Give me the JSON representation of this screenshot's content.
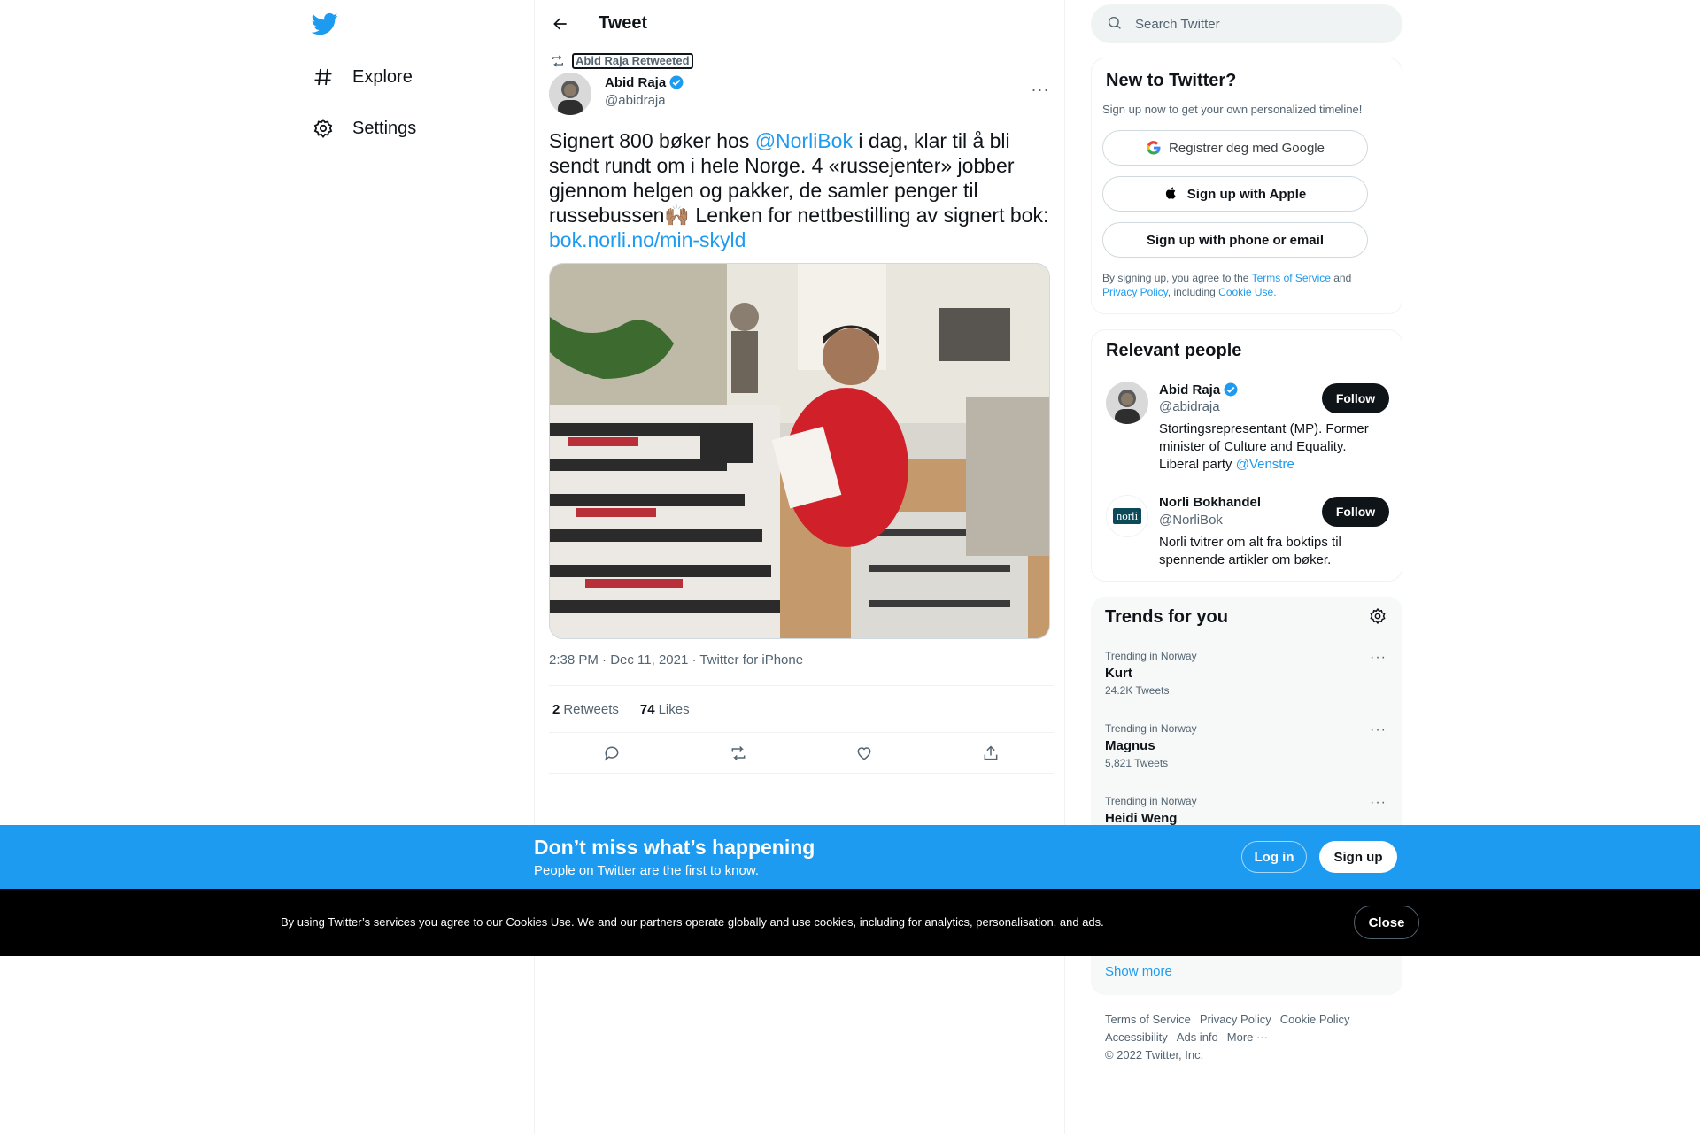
{
  "nav": {
    "explore_label": "Explore",
    "settings_label": "Settings"
  },
  "header": {
    "title": "Tweet"
  },
  "tweet": {
    "retweeted_by": "Abid Raja Retweeted",
    "author_name": "Abid Raja",
    "author_handle": "@abidraja",
    "text_before": "Signert 800 bøker hos ",
    "mention": "@NorliBok",
    "text_after": " i dag, klar til å bli sendt rundt om i hele Norge. 4 «russejenter» jobber gjennom helgen og pakker, de samler penger til russebussen🙌🏽 Lenken for nettbestilling av signert bok: ",
    "link": "bok.norli.no/min-skyld",
    "timestamp": "2:38 PM · Dec 11, 2021 · Twitter for iPhone",
    "retweets_count": "2",
    "retweets_label": "Retweets",
    "likes_count": "74",
    "likes_label": "Likes"
  },
  "search": {
    "placeholder": "Search Twitter"
  },
  "new_to_twitter": {
    "title": "New to Twitter?",
    "subtitle": "Sign up now to get your own personalized timeline!",
    "google_label": "Registrer deg med Google",
    "apple_label": "Sign up with Apple",
    "phone_label": "Sign up with phone or email",
    "legal_1": "By signing up, you agree to the ",
    "terms_link": "Terms of Service",
    "legal_2": " and ",
    "privacy_link": "Privacy Policy",
    "legal_3": ", including ",
    "cookie_link": "Cookie Use."
  },
  "relevant_people": {
    "title": "Relevant people",
    "people": [
      {
        "name": "Abid Raja",
        "handle": "@abidraja",
        "bio_text": "Stortingsrepresentant (MP). Former minister of Culture and Equality. Liberal party ",
        "bio_mention": "@Venstre",
        "follow_label": "Follow"
      },
      {
        "name": "Norli Bokhandel",
        "handle": "@NorliBok",
        "bio_text": "Norli tvitrer om alt fra boktips til spennende artikler om bøker.",
        "follow_label": "Follow",
        "logo_text": "norli"
      }
    ]
  },
  "trends": {
    "title": "Trends for you",
    "items": [
      {
        "context": "Trending in Norway",
        "name": "Kurt",
        "count": "24.2K Tweets"
      },
      {
        "context": "Trending in Norway",
        "name": "Magnus",
        "count": "5,821 Tweets"
      },
      {
        "context": "Trending in Norway",
        "name": "Heidi Weng",
        "count": ""
      }
    ],
    "show_more": "Show more"
  },
  "footer": {
    "links": [
      "Terms of Service",
      "Privacy Policy",
      "Cookie Policy",
      "Accessibility",
      "Ads info",
      "More ···"
    ],
    "copyright": "© 2022 Twitter, Inc."
  },
  "banner": {
    "title": "Don’t miss what’s happening",
    "subtitle": "People on Twitter are the first to know.",
    "login_label": "Log in",
    "signup_label": "Sign up"
  },
  "cookie_bar": {
    "text": "By using Twitter’s services you agree to our Cookies Use. We and our partners operate globally and use cookies, including for analytics, personalisation, and ads.",
    "close_label": "Close"
  },
  "colors": {
    "accent": "#1d9bf0",
    "text": "#0f1419",
    "secondary": "#536471",
    "cookie_bg": "#000000"
  }
}
